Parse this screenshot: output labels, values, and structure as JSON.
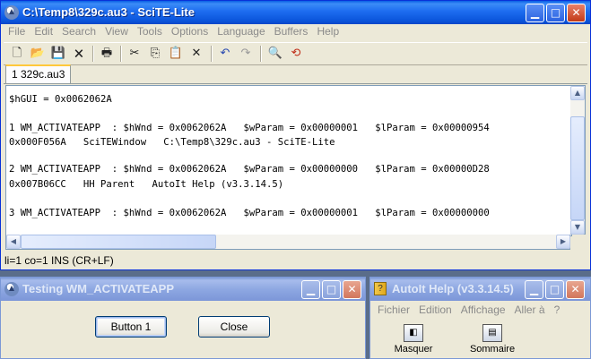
{
  "scite": {
    "title": "C:\\Temp8\\329c.au3 - SciTE-Lite",
    "menu": [
      "File",
      "Edit",
      "Search",
      "View",
      "Tools",
      "Options",
      "Language",
      "Buffers",
      "Help"
    ],
    "tab_label": "1 329c.au3",
    "editor_lines": [
      "$hGUI = 0x0062062A",
      "",
      "1 WM_ACTIVATEAPP  : $hWnd = 0x0062062A   $wParam = 0x00000001   $lParam = 0x00000954",
      "0x000F056A   SciTEWindow   C:\\Temp8\\329c.au3 - SciTE-Lite",
      "",
      "2 WM_ACTIVATEAPP  : $hWnd = 0x0062062A   $wParam = 0x00000000   $lParam = 0x00000D28",
      "0x007B06CC   HH Parent   AutoIt Help (v3.3.14.5)",
      "",
      "3 WM_ACTIVATEAPP  : $hWnd = 0x0062062A   $wParam = 0x00000001   $lParam = 0x00000000"
    ],
    "status": "li=1 co=1 INS (CR+LF)"
  },
  "testing": {
    "title": "Testing WM_ACTIVATEAPP",
    "button1_label": "Button 1",
    "close_label": "Close"
  },
  "help": {
    "title": "AutoIt Help (v3.3.14.5)",
    "menu": [
      "Fichier",
      "Edition",
      "Affichage",
      "Aller à",
      "?"
    ],
    "hide_label": "Masquer",
    "contents_label": "Sommaire"
  },
  "colors": {
    "titlebar_active": "#0a5fe4",
    "titlebar_inactive": "#7b98d6",
    "window_face": "#ece9d8",
    "desktop": "#5a6d8a"
  }
}
